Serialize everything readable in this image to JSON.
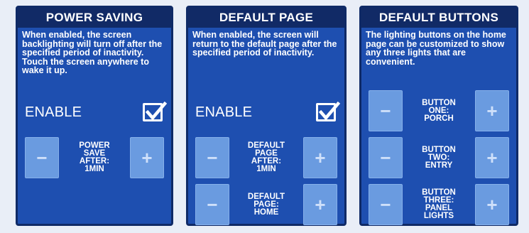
{
  "panels": {
    "power_saving": {
      "title": "POWER SAVING",
      "description": "When enabled, the screen backlighting will turn off after the specified period of inactivity. Touch the screen anywhere to wake it up.",
      "enable_label": "ENABLE",
      "enabled": true,
      "stepper": {
        "label": "POWER\nSAVE\nAFTER:\n1MIN",
        "minus": "−",
        "plus": "+"
      }
    },
    "default_page": {
      "title": "DEFAULT PAGE",
      "description": "When enabled, the screen will return to the default page after the specified period of inactivity.",
      "enable_label": "ENABLE",
      "enabled": true,
      "steppers": [
        {
          "label": "DEFAULT\nPAGE\nAFTER:\n1MIN",
          "minus": "−",
          "plus": "+"
        },
        {
          "label": "DEFAULT\nPAGE:\nHOME",
          "minus": "−",
          "plus": "+"
        }
      ]
    },
    "default_buttons": {
      "title": "DEFAULT BUTTONS",
      "description": "The lighting buttons on the home page can be customized to show any three lights that are convenient.",
      "steppers": [
        {
          "label": "BUTTON\nONE:\nPORCH",
          "minus": "−",
          "plus": "+"
        },
        {
          "label": "BUTTON\nTWO:\nENTRY",
          "minus": "−",
          "plus": "+"
        },
        {
          "label": "BUTTON\nTHREE:\nPANEL\nLIGHTS",
          "minus": "−",
          "plus": "+"
        }
      ]
    }
  },
  "colors": {
    "panel_bg": "#1e4fb0",
    "title_bar": "#112a66",
    "button_bg": "#6a9be0",
    "text": "#ffffff"
  },
  "icons": {
    "check": "checkmark-icon",
    "minus": "minus-icon",
    "plus": "plus-icon"
  }
}
